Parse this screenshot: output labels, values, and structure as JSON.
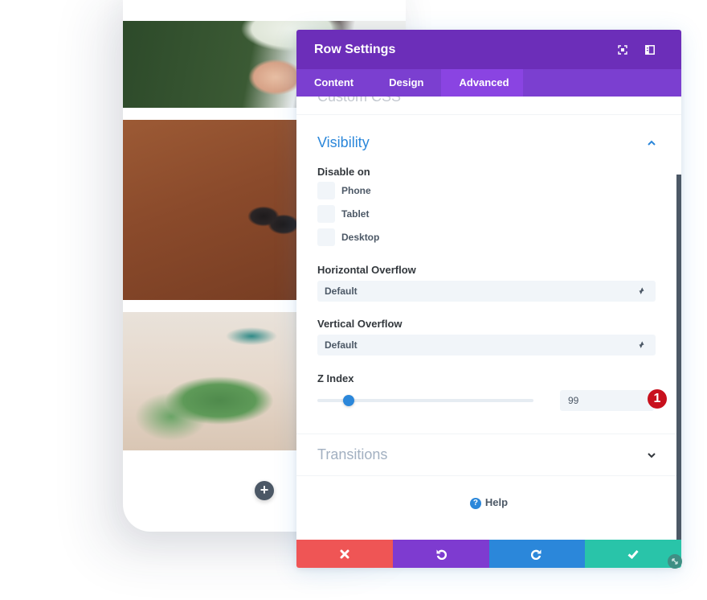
{
  "modal": {
    "title": "Row Settings",
    "header_icons": [
      "fullscreen-icon",
      "sidebar-dock-icon"
    ],
    "tabs": [
      {
        "label": "Content",
        "active": false
      },
      {
        "label": "Design",
        "active": false
      },
      {
        "label": "Advanced",
        "active": true
      }
    ],
    "cut_section_title": "Custom CSS",
    "visibility": {
      "title": "Visibility",
      "expanded": true,
      "disable_on_label": "Disable on",
      "options": [
        {
          "label": "Phone",
          "checked": false
        },
        {
          "label": "Tablet",
          "checked": false
        },
        {
          "label": "Desktop",
          "checked": false
        }
      ],
      "horizontal_overflow": {
        "label": "Horizontal Overflow",
        "value": "Default"
      },
      "vertical_overflow": {
        "label": "Vertical Overflow",
        "value": "Default"
      },
      "z_index": {
        "label": "Z Index",
        "value": "99",
        "slider_fraction": 0.12
      },
      "annotation_badge": "1"
    },
    "transitions": {
      "title": "Transitions",
      "expanded": false
    },
    "help": {
      "label": "Help",
      "icon": "?"
    },
    "footer": {
      "cancel_icon": "close-icon",
      "undo_icon": "undo-icon",
      "redo_icon": "redo-icon",
      "save_icon": "check-icon"
    },
    "colors": {
      "header": "#6c2eb9",
      "tabs": "#7b3fd0",
      "accent": "#2b87da",
      "cancel": "#ef5555",
      "undo": "#7e3bd0",
      "redo": "#2b87da",
      "save": "#29c4a9",
      "badge": "#c8101d"
    }
  },
  "preview": {
    "add_button_icon": "+"
  }
}
